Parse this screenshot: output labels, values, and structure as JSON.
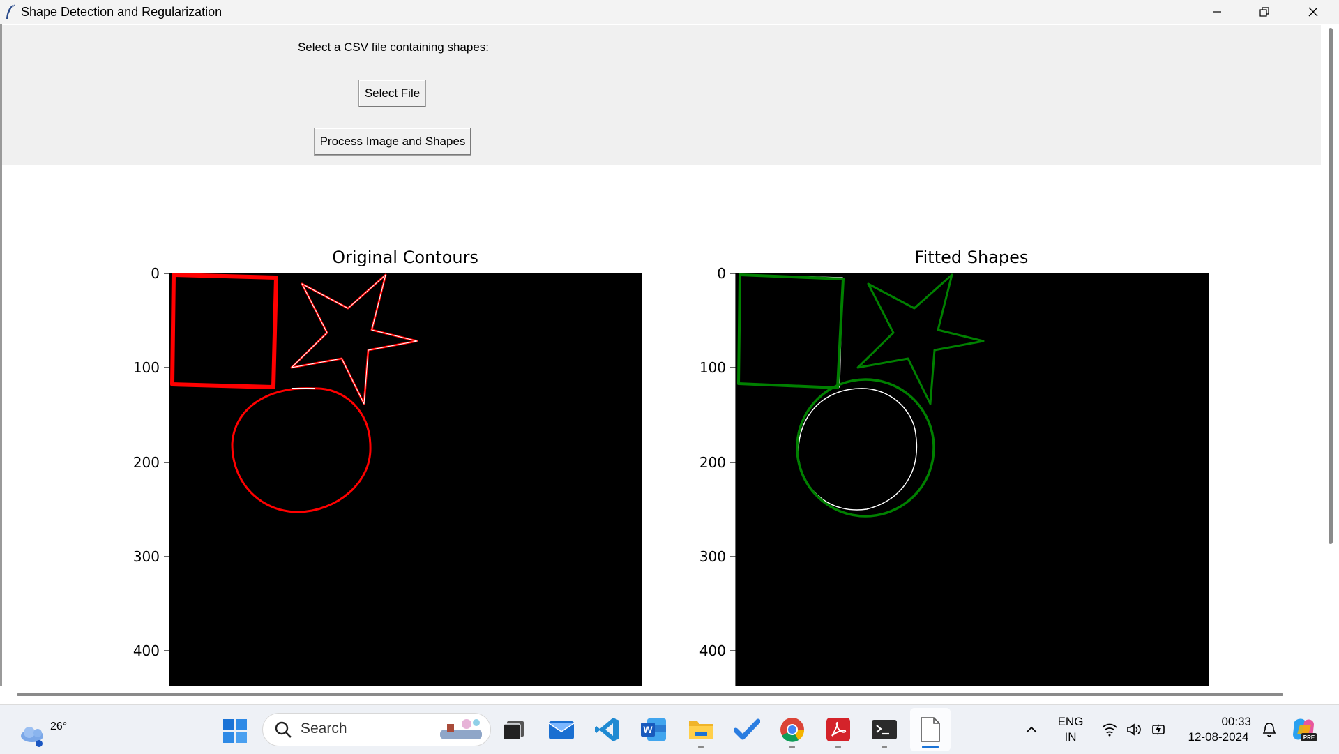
{
  "window": {
    "title": "Shape Detection and Regularization",
    "controls": [
      "minimize",
      "restore",
      "close"
    ]
  },
  "controls": {
    "prompt": "Select a CSV file containing shapes:",
    "select_file_label": "Select File",
    "process_label": "Process Image and Shapes"
  },
  "chart_data": [
    {
      "type": "image",
      "title": "Original Contours",
      "yticks": [
        0,
        100,
        200,
        300,
        400
      ],
      "shapes": [
        "rectangle",
        "star",
        "circle"
      ],
      "stroke_color": "#ff0000"
    },
    {
      "type": "image",
      "title": "Fitted Shapes",
      "yticks": [
        0,
        100,
        200,
        300,
        400
      ],
      "shapes": [
        "rectangle",
        "star",
        "circle"
      ],
      "stroke_color": "#008000",
      "overlay_color": "#ffffff"
    }
  ],
  "taskbar": {
    "weather_temp": "26°",
    "search_placeholder": "Search",
    "apps": [
      "start-icon",
      "search",
      "task-view-icon",
      "mail-icon",
      "vscode-icon",
      "word-icon",
      "file-explorer-icon",
      "todo-icon",
      "chrome-icon",
      "acrobat-icon",
      "terminal-icon",
      "notepad-icon"
    ],
    "lang_top": "ENG",
    "lang_bottom": "IN",
    "time": "00:33",
    "date": "12-08-2024"
  },
  "colors": {
    "panel_bg": "#f0f0f0",
    "original_stroke": "#ff0000",
    "fitted_stroke": "#008000",
    "plot_bg": "#000000"
  }
}
